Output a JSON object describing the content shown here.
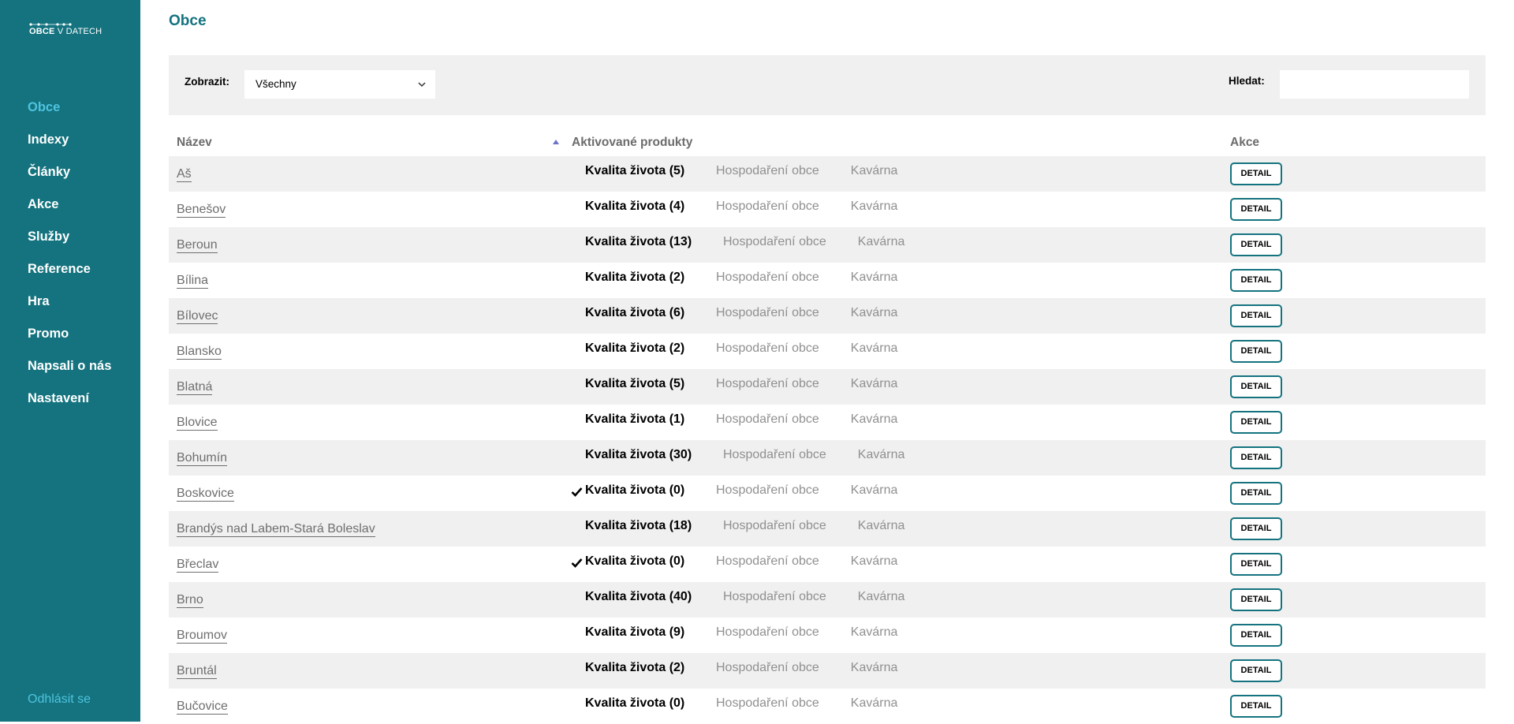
{
  "logo": {
    "bold": "OBCE",
    "rest": " V DATECH"
  },
  "sidebar": {
    "items": [
      {
        "label": "Obce",
        "active": true
      },
      {
        "label": "Indexy"
      },
      {
        "label": "Články"
      },
      {
        "label": "Akce"
      },
      {
        "label": "Služby"
      },
      {
        "label": "Reference"
      },
      {
        "label": "Hra"
      },
      {
        "label": "Promo"
      },
      {
        "label": "Napsali o nás"
      },
      {
        "label": "Nastavení"
      }
    ],
    "logout": "Odhlásit se"
  },
  "page": {
    "title": "Obce"
  },
  "filter": {
    "label": "Zobrazit:",
    "selected": "Všechny"
  },
  "search": {
    "label": "Hledat:",
    "value": ""
  },
  "table": {
    "headers": {
      "name": "Název",
      "products": "Aktivované produkty",
      "actions": "Akce"
    },
    "product_labels": {
      "finance": "Hospodaření obce",
      "cafe": "Kavárna"
    },
    "detail_label": "DETAIL",
    "rows": [
      {
        "name": "Aš",
        "quality": "Kvalita života (5)",
        "checked": false
      },
      {
        "name": "Benešov",
        "quality": "Kvalita života (4)",
        "checked": false
      },
      {
        "name": "Beroun",
        "quality": "Kvalita života (13)",
        "checked": false
      },
      {
        "name": "Bílina",
        "quality": "Kvalita života (2)",
        "checked": false
      },
      {
        "name": "Bílovec",
        "quality": "Kvalita života (6)",
        "checked": false
      },
      {
        "name": "Blansko",
        "quality": "Kvalita života (2)",
        "checked": false
      },
      {
        "name": "Blatná",
        "quality": "Kvalita života (5)",
        "checked": false
      },
      {
        "name": "Blovice",
        "quality": "Kvalita života (1)",
        "checked": false
      },
      {
        "name": "Bohumín",
        "quality": "Kvalita života (30)",
        "checked": false
      },
      {
        "name": "Boskovice",
        "quality": "Kvalita života (0)",
        "checked": true
      },
      {
        "name": "Brandýs nad Labem-Stará Boleslav",
        "quality": "Kvalita života (18)",
        "checked": false
      },
      {
        "name": "Břeclav",
        "quality": "Kvalita života (0)",
        "checked": true
      },
      {
        "name": "Brno",
        "quality": "Kvalita života (40)",
        "checked": false
      },
      {
        "name": "Broumov",
        "quality": "Kvalita života (9)",
        "checked": false
      },
      {
        "name": "Bruntál",
        "quality": "Kvalita života (2)",
        "checked": false
      },
      {
        "name": "Bučovice",
        "quality": "Kvalita života (0)",
        "checked": false
      }
    ]
  },
  "colors": {
    "sidebar": "#14737f",
    "accent": "#4fc3de",
    "row_alt": "#f0f0f0"
  }
}
